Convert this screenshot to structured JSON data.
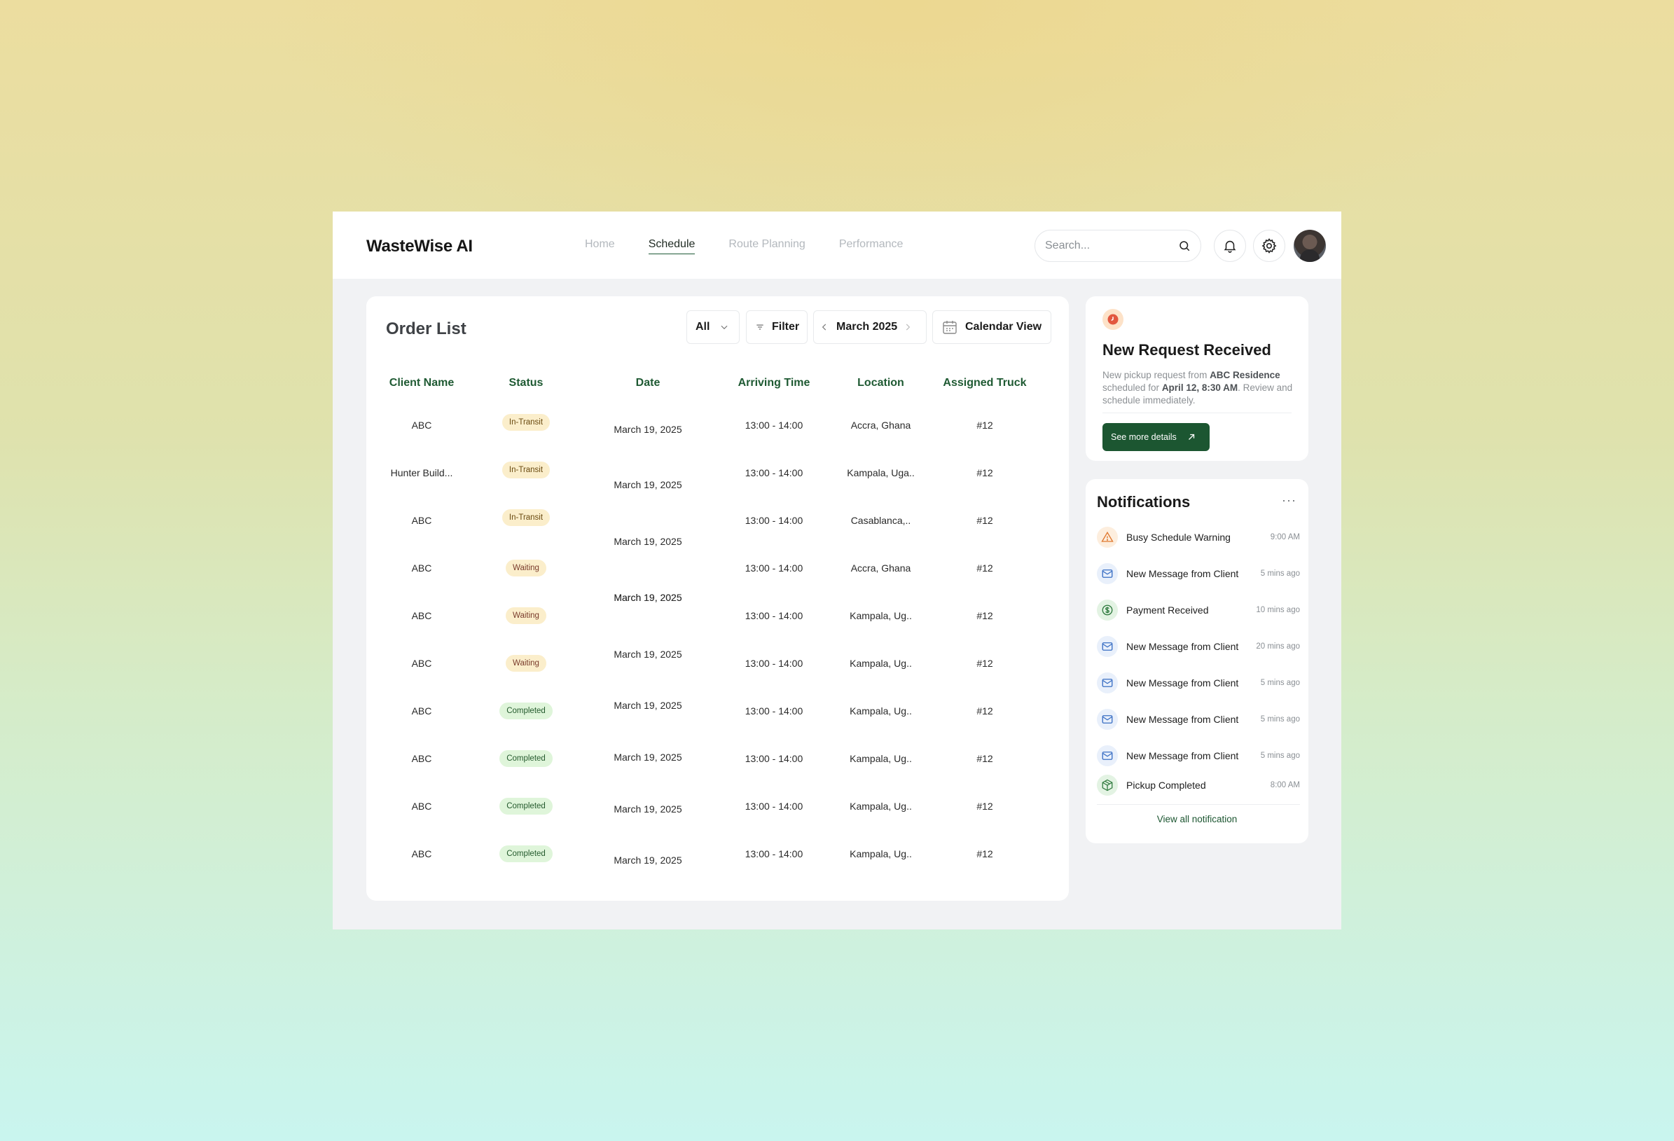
{
  "app": {
    "title": "WasteWise AI"
  },
  "nav": {
    "items": [
      {
        "label": "Home"
      },
      {
        "label": "Schedule"
      },
      {
        "label": "Route Planning"
      },
      {
        "label": "Performance"
      }
    ],
    "active": "Schedule"
  },
  "search": {
    "placeholder": "Search..."
  },
  "orders": {
    "title": "Order List",
    "filter_all": "All",
    "filter_label": "Filter",
    "month": "March 2025",
    "calendar_view": "Calendar View",
    "columns": [
      "Client Name",
      "Status",
      "Date",
      "Arriving Time",
      "Location",
      "Assigned Truck"
    ],
    "rows": [
      {
        "client": "ABC",
        "status": "In-Transit",
        "date": "March 19, 2025",
        "time": "13:00 - 14:00",
        "location": "Accra, Ghana",
        "truck": "#12"
      },
      {
        "client": "Hunter Build...",
        "status": "In-Transit",
        "date": "March 19, 2025",
        "time": "13:00 - 14:00",
        "location": "Kampala, Uga..",
        "truck": "#12"
      },
      {
        "client": "ABC",
        "status": "In-Transit",
        "date": "March 19, 2025",
        "time": "13:00 - 14:00",
        "location": "Casablanca,..",
        "truck": "#12"
      },
      {
        "client": "ABC",
        "status": "Waiting",
        "date": "March 19, 2025",
        "time": "13:00 - 14:00",
        "location": "Accra, Ghana",
        "truck": "#12"
      },
      {
        "client": "ABC",
        "status": "Waiting",
        "date": "March 19, 2025",
        "time": "13:00 - 14:00",
        "location": "Kampala, Ug..",
        "truck": "#12"
      },
      {
        "client": "ABC",
        "status": "Waiting",
        "date": "March 19, 2025",
        "time": "13:00 - 14:00",
        "location": "Kampala, Ug..",
        "truck": "#12"
      },
      {
        "client": "ABC",
        "status": "Completed",
        "date": "March 19, 2025",
        "time": "13:00 - 14:00",
        "location": "Kampala, Ug..",
        "truck": "#12"
      },
      {
        "client": "ABC",
        "status": "Completed",
        "date": "March 19, 2025",
        "time": "13:00 - 14:00",
        "location": "Kampala, Ug..",
        "truck": "#12"
      },
      {
        "client": "ABC",
        "status": "Completed",
        "date": "March 19, 2025",
        "time": "13:00 - 14:00",
        "location": "Kampala, Ug..",
        "truck": "#12"
      },
      {
        "client": "ABC",
        "status": "Completed",
        "date": "March 19, 2025",
        "time": "13:00 - 14:00",
        "location": "Kampala, Ug..",
        "truck": "#12"
      }
    ]
  },
  "request": {
    "title": "New Request Received",
    "text_prefix": "New pickup request from ",
    "client": "ABC Residence",
    "text_mid": " scheduled for ",
    "when": "April 12, 8:30 AM",
    "text_suffix": ". Review and schedule immediately.",
    "button": "See more details"
  },
  "notifications": {
    "title": "Notifications",
    "more": "···",
    "items": [
      {
        "icon": "warning-icon",
        "label": "Busy Schedule Warning",
        "time": "9:00 AM"
      },
      {
        "icon": "mail-icon",
        "label": "New Message from Client",
        "time": "5 mins ago"
      },
      {
        "icon": "dollar-icon",
        "label": "Payment Received",
        "time": "10 mins ago"
      },
      {
        "icon": "mail-icon",
        "label": "New Message from Client",
        "time": "20 mins ago"
      },
      {
        "icon": "mail-icon",
        "label": "New Message from Client",
        "time": "5 mins ago"
      },
      {
        "icon": "mail-icon",
        "label": "New Message from Client",
        "time": "5 mins ago"
      },
      {
        "icon": "mail-icon",
        "label": "New Message from Client",
        "time": "5 mins ago"
      },
      {
        "icon": "package-icon",
        "label": "Pickup Completed",
        "time": "8:00 AM"
      }
    ],
    "view_all": "View all notification"
  },
  "colors": {
    "brand_green": "#1c5631",
    "header_green": "#1f5a33",
    "transit_bg": "#fbeecb",
    "completed_bg": "#dff5da",
    "alert_red": "#e2573f"
  }
}
